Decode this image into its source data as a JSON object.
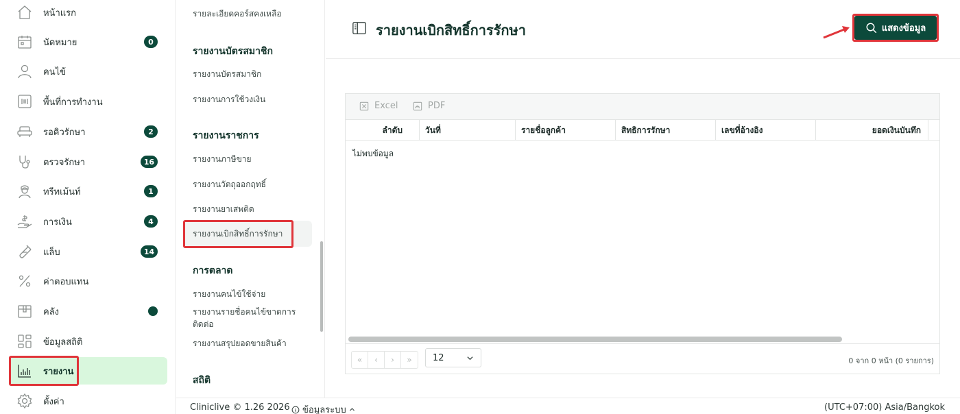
{
  "sidebar": {
    "items": [
      {
        "label": "หน้าแรก",
        "icon": "home-icon",
        "badge": ""
      },
      {
        "label": "นัดหมาย",
        "icon": "calendar-icon",
        "badge": "0"
      },
      {
        "label": "คนไข้",
        "icon": "user-icon",
        "badge": ""
      },
      {
        "label": "พื้นที่การทำงาน",
        "icon": "workspace-icon",
        "badge": ""
      },
      {
        "label": "รอคิวรักษา",
        "icon": "sofa-icon",
        "badge": "2"
      },
      {
        "label": "ตรวจรักษา",
        "icon": "stethoscope-icon",
        "badge": "16"
      },
      {
        "label": "ทรีทเม้นท์",
        "icon": "nurse-icon",
        "badge": "1"
      },
      {
        "label": "การเงิน",
        "icon": "money-hand-icon",
        "badge": "4"
      },
      {
        "label": "แล็บ",
        "icon": "test-tube-icon",
        "badge": "14"
      },
      {
        "label": "ค่าตอบแทน",
        "icon": "percent-icon",
        "badge": ""
      },
      {
        "label": "คลัง",
        "icon": "box-icon",
        "badge": ""
      },
      {
        "label": "ข้อมูลสถิติ",
        "icon": "dashboard-icon",
        "badge": ""
      },
      {
        "label": "รายงาน",
        "icon": "bar-chart-icon",
        "badge": ""
      },
      {
        "label": "ตั้งค่า",
        "icon": "gear-icon",
        "badge": ""
      }
    ],
    "accent": "#0c4a3b",
    "active_bg": "#d9f7dd"
  },
  "submenu": {
    "top_link": "รายละเอียดคอร์สคงเหลือ",
    "sections": [
      {
        "heading": "รายงานบัตรสมาชิก",
        "links": [
          "รายงานบัตรสมาชิก",
          "รายงานการใช้วงเงิน"
        ]
      },
      {
        "heading": "รายงานราชการ",
        "links": [
          "รายงานภาษีขาย",
          "รายงานวัตถุออกฤทธิ์",
          "รายงานยาเสพติด",
          "รายงานเบิกสิทธิ์การรักษา"
        ]
      },
      {
        "heading": "การตลาด",
        "links": [
          "รายงานคนไข้ใช้จ่าย",
          "รายงานรายชื่อคนไข้ขาดการติดต่อ",
          "รายงานสรุปยอดขายสินค้า"
        ]
      },
      {
        "heading": "สถิติ",
        "links": []
      }
    ]
  },
  "header": {
    "title": "รายงานเบิกสิทธิ์การรักษา",
    "show_button": "แสดงข้อมูล"
  },
  "grid": {
    "toolbar": {
      "excel": "Excel",
      "pdf": "PDF"
    },
    "columns": [
      "ลำดับ",
      "วันที่",
      "รายชื่อลูกค้า",
      "สิทธิการรักษา",
      "เลขที่อ้างอิง",
      "ยอดเงินบันทึก"
    ],
    "empty_text": "ไม่พบข้อมูล",
    "pager": {
      "first": "«",
      "prev": "‹",
      "next": "›",
      "last": "»",
      "page_size": "12",
      "info": "0 จาก 0 หน้า (0 รายการ)"
    }
  },
  "footer": {
    "brand": "Cliniclive © 1.26 2026",
    "system_info": "ข้อมูลระบบ",
    "timezone": "(UTC+07:00) Asia/Bangkok"
  }
}
